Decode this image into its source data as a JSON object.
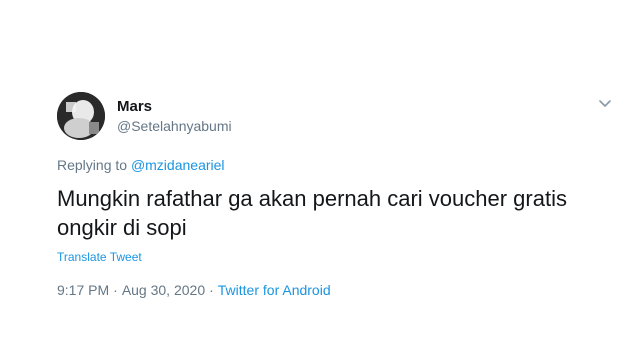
{
  "user": {
    "name": "Mars",
    "handle": "@Setelahnyabumi"
  },
  "reply": {
    "prefix": "Replying to",
    "mention": "@mzidaneariel"
  },
  "tweet": {
    "text": "Mungkin rafathar ga akan pernah cari voucher gratis ongkir di sopi"
  },
  "translate_label": "Translate Tweet",
  "meta": {
    "time": "9:17 PM",
    "separator": "·",
    "date": "Aug 30, 2020",
    "source": "Twitter for Android"
  },
  "icons": {
    "more": "chevron-down-icon"
  },
  "colors": {
    "link": "#1b95e0",
    "secondary": "#657786",
    "primary": "#14171a"
  }
}
